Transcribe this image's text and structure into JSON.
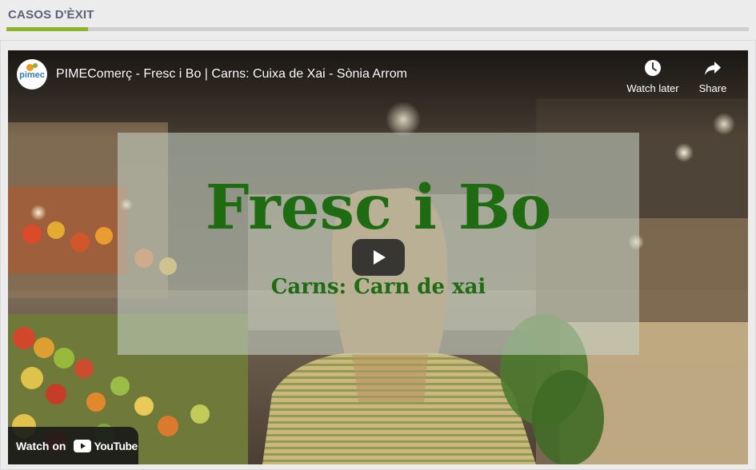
{
  "section": {
    "title": "CASOS D'ÈXIT",
    "accent_color": "#8db32b"
  },
  "video": {
    "channel_avatar_text": "pimec",
    "title": "PIMEComerç - Fresc i Bo | Carns: Cuixa de Xai - Sònia Arrom",
    "watch_later_label": "Watch later",
    "share_label": "Share",
    "overlay_title": "Fresc i Bo",
    "overlay_subtitle": "Carns: Carn de xai",
    "overlay_text_color": "#1e6b12",
    "watch_on_label": "Watch on",
    "youtube_wordmark": "YouTube",
    "play_icon": "play-icon"
  }
}
